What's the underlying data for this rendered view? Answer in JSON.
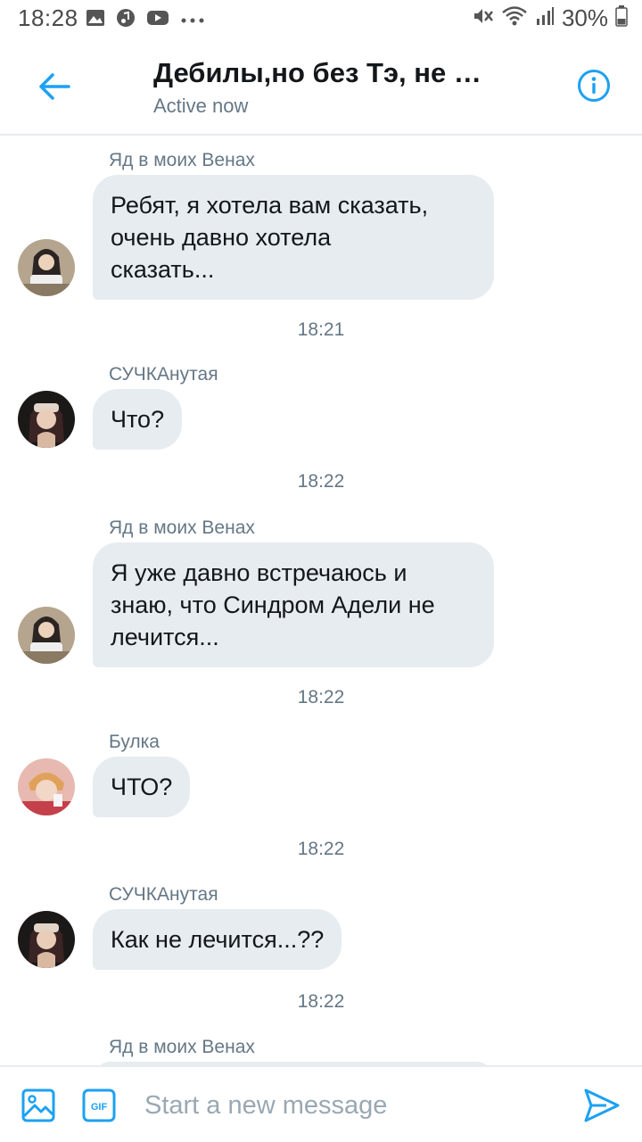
{
  "status_bar": {
    "time": "18:28",
    "battery": "30%",
    "icons_left": [
      "gallery-icon",
      "music-icon",
      "youtube-icon",
      "more-dots-icon"
    ],
    "icons_right": [
      "mute-icon",
      "wifi-icon",
      "signal-icon",
      "battery-icon"
    ]
  },
  "header": {
    "title": "Дебилы,но без Тэ, не …",
    "status": "Active now"
  },
  "colors": {
    "accent": "#1da1f2",
    "bubble": "#e6ecf0",
    "secondary_text": "#657786"
  },
  "messages": [
    {
      "sender": "Яд в моих Венах",
      "lines": [
        "Ребят, я хотела вам сказать,",
        "очень давно хотела",
        "сказать..."
      ],
      "time": "18:21"
    },
    {
      "sender": "СУЧКАнутая",
      "lines": [
        "Что?"
      ],
      "time": "18:22"
    },
    {
      "sender": "Яд в моих Венах",
      "lines": [
        "Я уже давно встречаюсь и",
        "знаю, что Синдром Адели не",
        "лечится..."
      ],
      "time": "18:22"
    },
    {
      "sender": "Булка",
      "lines": [
        "ЧТО?"
      ],
      "time": "18:22"
    },
    {
      "sender": "СУЧКАнутая",
      "lines": [
        "Как не лечится...??"
      ],
      "time": "18:22"
    },
    {
      "sender": "Яд в моих Венах",
      "lines": [],
      "time": ""
    }
  ],
  "composer": {
    "placeholder": "Start a new message",
    "gif_label": "GIF"
  }
}
